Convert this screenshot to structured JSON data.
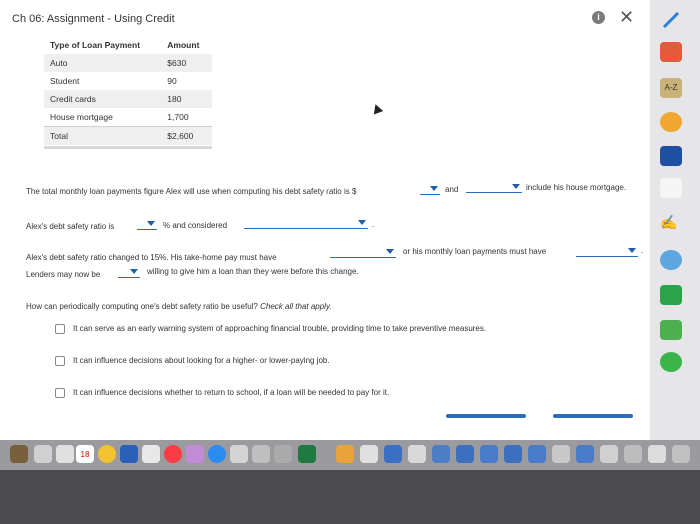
{
  "header": {
    "title": "Ch 06: Assignment - Using Credit",
    "info_label": "i",
    "close_label": "✕"
  },
  "loan_table": {
    "headers": [
      "Type of Loan Payment",
      "Amount"
    ],
    "rows": [
      {
        "type": "Auto",
        "amount": "$630"
      },
      {
        "type": "Student",
        "amount": "90"
      },
      {
        "type": "Credit cards",
        "amount": "180"
      },
      {
        "type": "House mortgage",
        "amount": "1,700"
      },
      {
        "type": "Total",
        "amount": "$2,600"
      }
    ]
  },
  "q1": {
    "prefix": "The total monthly loan payments figure Alex will use when computing his debt safety ratio is $",
    "and": "and",
    "suffix": "include his house mortgage."
  },
  "q2": {
    "prefix": "Alex's debt safety ratio is",
    "middle": "% and considered",
    "end": "."
  },
  "q3": {
    "line1_prefix": "Alex's debt safety ratio changed to 15%. His take-home pay must have",
    "line1_middle": "or his monthly loan payments must have",
    "line1_end": ".",
    "line2_prefix": "Lenders may now be",
    "line2_suffix": "willing to give him a loan than they were before this change."
  },
  "q4": {
    "prompt": "How can periodically computing one's debt safety ratio be useful?",
    "instruction": "Check all that apply.",
    "options": [
      "It can serve as an early warning system of approaching financial trouble, providing time to take preventive measures.",
      "It can influence decisions about looking for a higher- or lower-paying job.",
      "It can influence decisions whether to return to school, if a loan will be needed to pay for it."
    ]
  },
  "dock": {
    "calendar_day": "18"
  },
  "right_dock": {
    "dictionary_label": "A-Z"
  },
  "colors": {
    "accent": "#2a6ebb",
    "page_bg": "#ffffff",
    "dock_bg": "#4b4b4d"
  }
}
